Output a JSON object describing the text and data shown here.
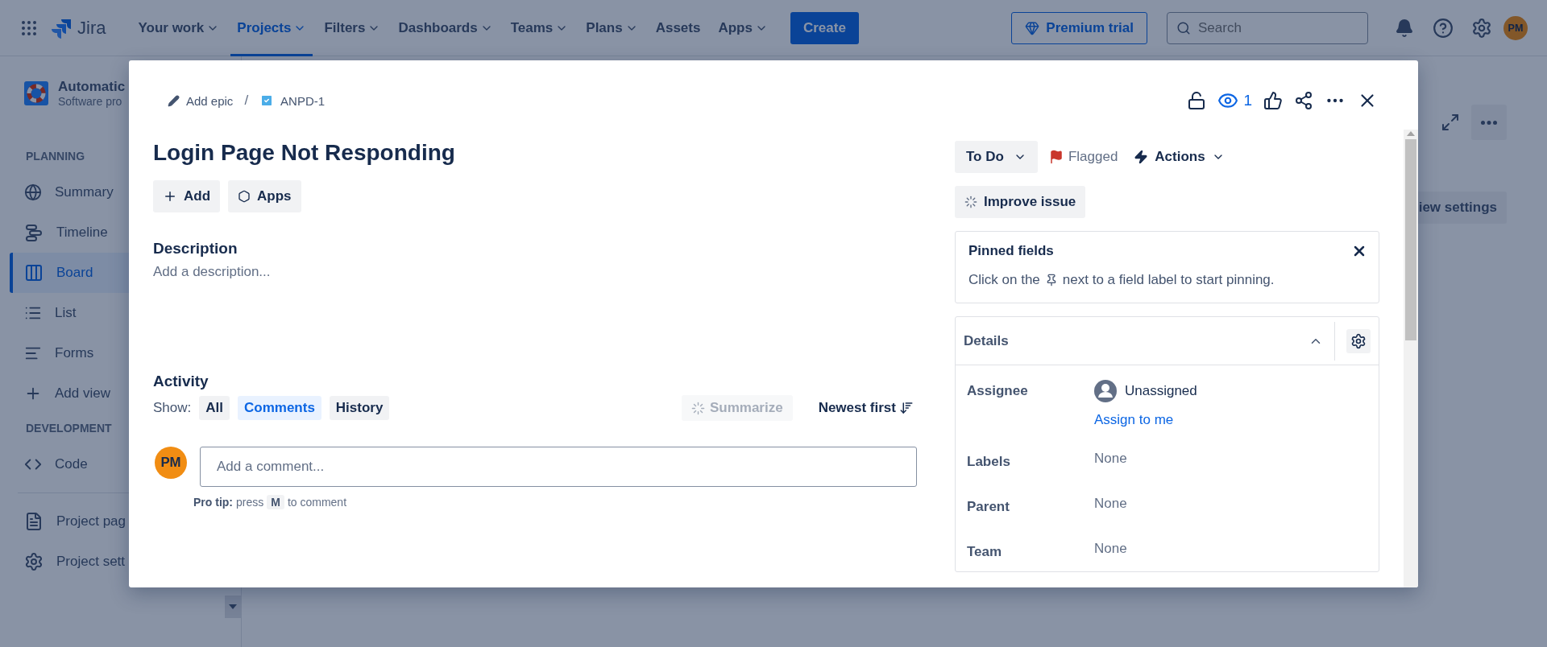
{
  "top_nav": {
    "product": "Jira",
    "items": [
      {
        "label": "Your work",
        "dropdown": true,
        "selected": false
      },
      {
        "label": "Projects",
        "dropdown": true,
        "selected": true
      },
      {
        "label": "Filters",
        "dropdown": true,
        "selected": false
      },
      {
        "label": "Dashboards",
        "dropdown": true,
        "selected": false
      },
      {
        "label": "Teams",
        "dropdown": true,
        "selected": false
      },
      {
        "label": "Plans",
        "dropdown": true,
        "selected": false
      },
      {
        "label": "Assets",
        "dropdown": false,
        "selected": false
      },
      {
        "label": "Apps",
        "dropdown": true,
        "selected": false
      }
    ],
    "create": "Create",
    "premium": "Premium trial",
    "search": {
      "placeholder": "Search"
    },
    "avatar": "PM"
  },
  "sidebar": {
    "project": {
      "name": "Automatic",
      "type": "Software pro"
    },
    "sections": [
      {
        "heading": "PLANNING",
        "items": [
          {
            "label": "Summary",
            "kind": "globe",
            "selected": false
          },
          {
            "label": "Timeline",
            "kind": "timeline",
            "selected": false
          },
          {
            "label": "Board",
            "kind": "board",
            "selected": true
          },
          {
            "label": "List",
            "kind": "list",
            "selected": false
          },
          {
            "label": "Forms",
            "kind": "forms",
            "selected": false
          },
          {
            "label": "Add view",
            "kind": "plus",
            "selected": false
          }
        ]
      },
      {
        "heading": "DEVELOPMENT",
        "items": [
          {
            "label": "Code",
            "kind": "code",
            "selected": false
          }
        ]
      },
      {
        "items": [
          {
            "label": "Project pag",
            "kind": "page",
            "selected": false
          },
          {
            "label": "Project sett",
            "kind": "settings",
            "selected": false
          }
        ]
      }
    ]
  },
  "board": {
    "view_settings": "iew settings"
  },
  "issue": {
    "breadcrumb": {
      "epic": "Add epic",
      "separator": "/",
      "key": "ANPD-1"
    },
    "watchers": "1",
    "title": "Login Page Not Responding",
    "actions": [
      {
        "label": "Add",
        "kind": "plus"
      },
      {
        "label": "Apps",
        "kind": "apps"
      }
    ],
    "description": {
      "heading": "Description",
      "prompt": "Add a description..."
    },
    "activity": {
      "heading": "Activity",
      "show_label": "Show:",
      "filters": [
        {
          "label": "All",
          "selected": false
        },
        {
          "label": "Comments",
          "selected": true
        },
        {
          "label": "History",
          "selected": false
        }
      ],
      "summarize": {
        "label": "Summarize",
        "disabled": true
      },
      "sort": "Newest first",
      "comment": {
        "avatar": "PM",
        "placeholder": "Add a comment..."
      },
      "tip": {
        "label": "Pro tip:",
        "before": "press",
        "key": "M",
        "after": "to comment"
      }
    },
    "status": "To Do",
    "flag": "Flagged",
    "automation": "Actions",
    "improve": "Improve issue",
    "pinned": {
      "title": "Pinned fields",
      "before": "Click on the",
      "after": "next to a field label to start pinning."
    },
    "details": {
      "title": "Details",
      "expanded": true,
      "fields": [
        {
          "label": "Assignee",
          "kind": "user",
          "value": "Unassigned",
          "action": "Assign to me"
        },
        {
          "label": "Labels",
          "kind": "empty",
          "value": "None"
        },
        {
          "label": "Parent",
          "kind": "empty",
          "value": "None"
        },
        {
          "label": "Team",
          "kind": "empty",
          "value": "None"
        }
      ]
    }
  }
}
